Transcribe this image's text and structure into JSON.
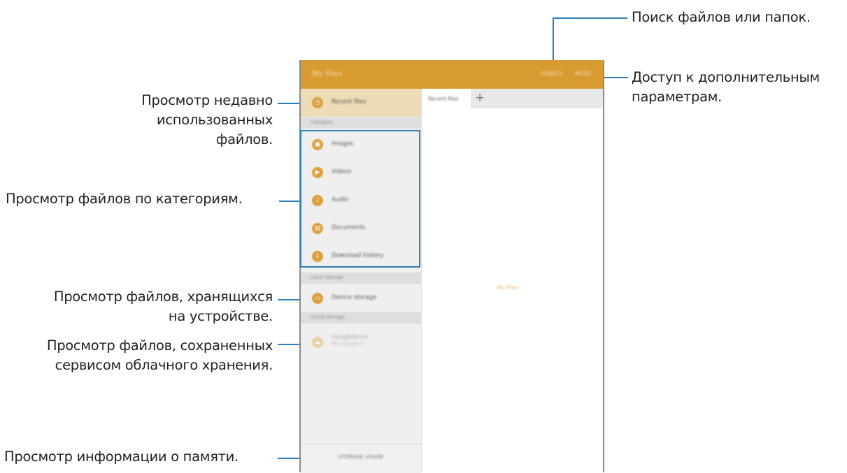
{
  "callouts": {
    "recent": "Просмотр недавно\nиспользованных файлов.",
    "recent_l1": "Просмотр недавно",
    "recent_l2": "использованных файлов.",
    "category": "Просмотр файлов по категориям.",
    "device_l1": "Просмотр файлов, хранящихся",
    "device_l2": "на устройстве.",
    "cloud_l1": "Просмотр файлов, сохраненных",
    "cloud_l2": "сервисом облачного хранения.",
    "memory": "Просмотр информации о памяти.",
    "search": "Поиск файлов или папок.",
    "more_l1": "Доступ к дополнительным",
    "more_l2": "параметрам."
  },
  "app": {
    "title": "My Files",
    "search_label": "SEARCH",
    "more_label": "MORE"
  },
  "sidebar": {
    "recent": {
      "label": "Recent files",
      "icon": "clock-icon"
    },
    "category_header": "Category",
    "items": [
      {
        "label": "Images",
        "icon": "image-icon"
      },
      {
        "label": "Videos",
        "icon": "video-icon"
      },
      {
        "label": "Audio",
        "icon": "music-note-icon"
      },
      {
        "label": "Documents",
        "icon": "document-icon"
      },
      {
        "label": "Download history",
        "icon": "download-icon"
      }
    ],
    "local_header": "Local storage",
    "device_storage": {
      "label": "Device storage",
      "icon": "device-icon"
    },
    "cloud_header": "Cloud storage",
    "cloud": {
      "label": "GoogleDrive",
      "sub": "Not signed in",
      "icon": "cloud-icon"
    },
    "storage_usage": "STORAGE USAGE"
  },
  "main": {
    "tab_recent": "Recent files",
    "tab_add": "+",
    "empty": "No files"
  },
  "colors": {
    "accent": "#d89b32",
    "callout_line": "#2a7fb8"
  }
}
